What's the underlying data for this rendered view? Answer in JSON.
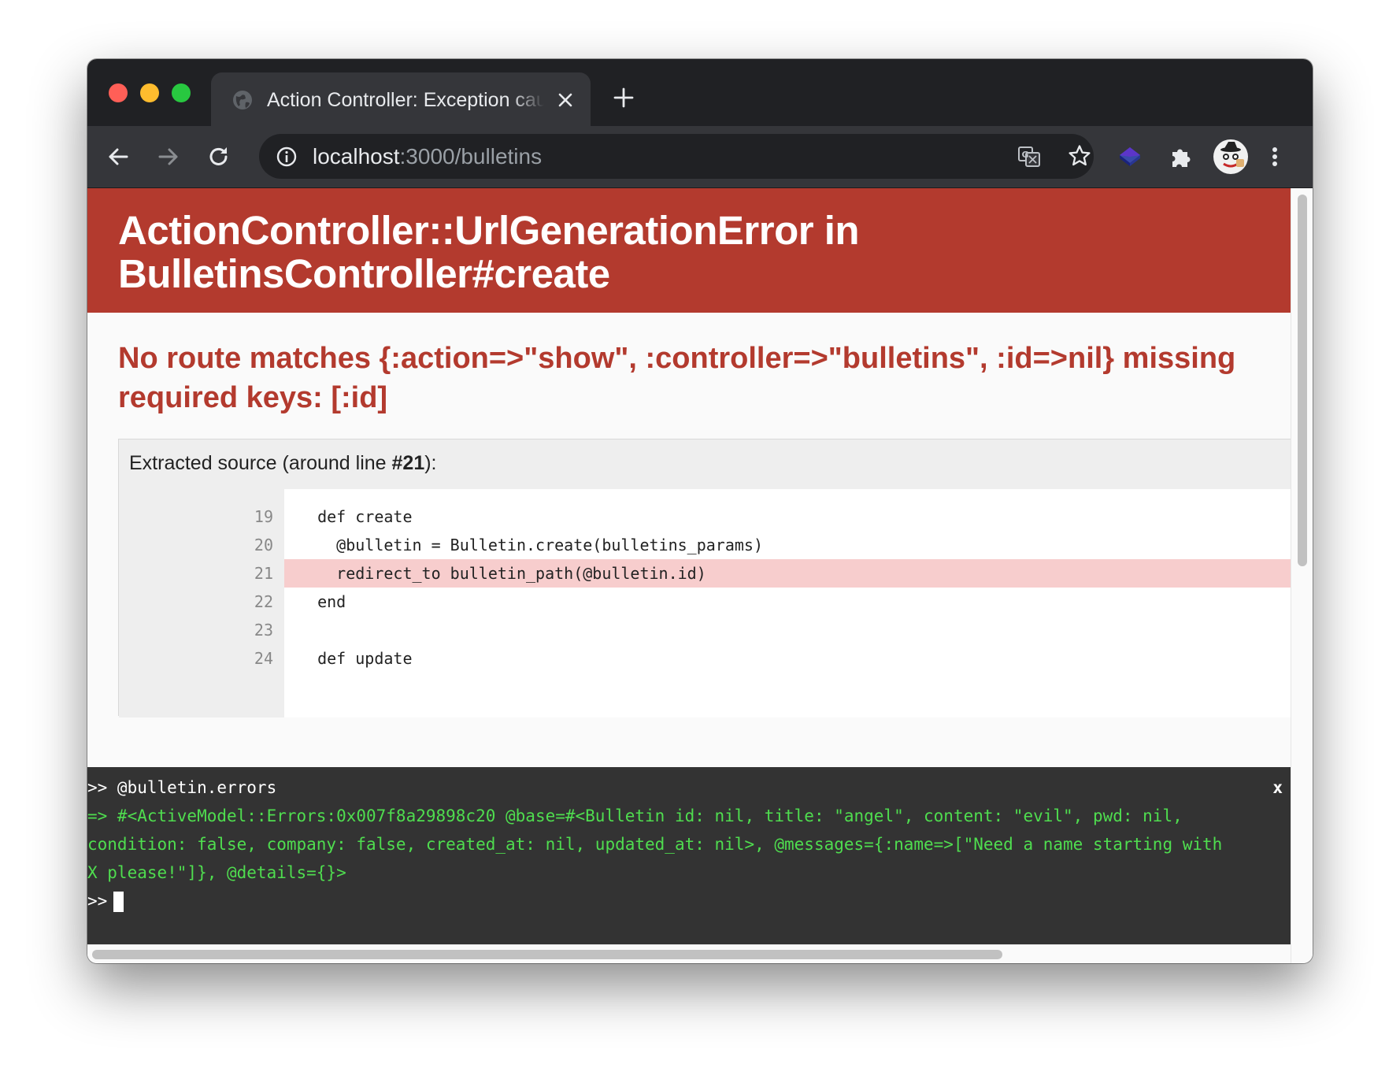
{
  "browser": {
    "tab_title": "Action Controller: Exception caught",
    "url_host": "localhost",
    "url_rest": ":3000/bulletins"
  },
  "page": {
    "error_title": "ActionController::UrlGenerationError in BulletinsController#create",
    "error_message": "No route matches {:action=>\"show\", :controller=>\"bulletins\", :id=>nil} missing required keys: [:id]",
    "source_label_prefix": "Extracted source (around line ",
    "source_label_line": "#21",
    "source_label_suffix": "):",
    "code_lines": [
      {
        "no": "19",
        "code": "  def create"
      },
      {
        "no": "20",
        "code": "    @bulletin = Bulletin.create(bulletins_params)"
      },
      {
        "no": "21",
        "code": "    redirect_to bulletin_path(@bulletin.id)"
      },
      {
        "no": "22",
        "code": "  end"
      },
      {
        "no": "23",
        "code": ""
      },
      {
        "no": "24",
        "code": "  def update"
      }
    ],
    "highlighted_line": "21"
  },
  "console": {
    "close_label": "x",
    "input_line": ">> @bulletin.errors",
    "output_lines": [
      "=> #<ActiveModel::Errors:0x007f8a29898c20 @base=#<Bulletin id: nil, title: \"angel\", content: \"evil\", pwd: nil,",
      "condition: false, company: false, created_at: nil, updated_at: nil>, @messages={:name=>[\"Need a name starting with",
      "X please!\"]}, @details={}>"
    ],
    "prompt": ">>"
  },
  "icons": [
    "globe-icon",
    "close-icon",
    "plus-icon",
    "back-icon",
    "forward-icon",
    "reload-icon",
    "info-icon",
    "translate-icon",
    "star-icon",
    "extension-layers-icon",
    "puzzle-icon",
    "avatar",
    "more-icon"
  ],
  "colors": {
    "header_red": "#b33a2e",
    "console_bg": "#333333",
    "console_output": "#4fdd4f",
    "highlight_line": "#f7cdcd"
  }
}
